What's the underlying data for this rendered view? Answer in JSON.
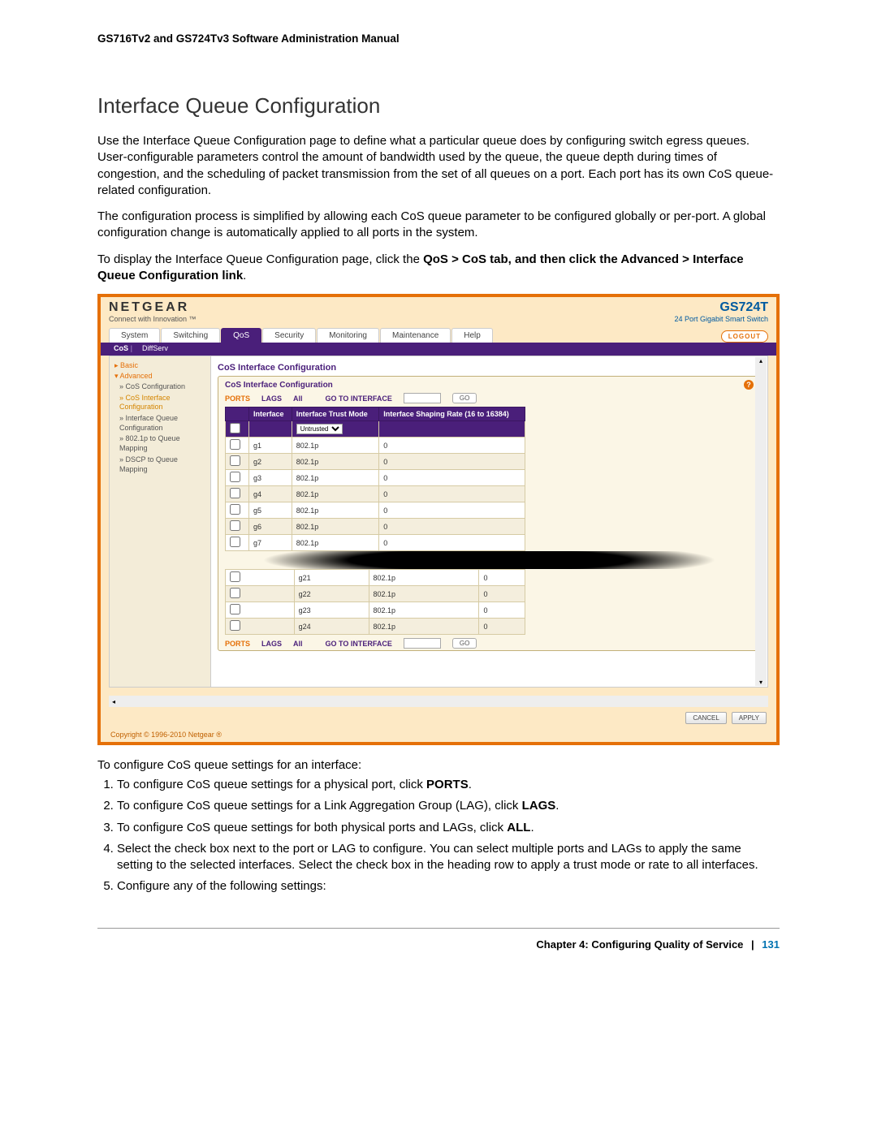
{
  "manual_header": "GS716Tv2 and GS724Tv3 Software Administration Manual",
  "h1": "Interface Queue Configuration",
  "para1": "Use the Interface Queue Configuration page to define what a particular queue does by configuring switch egress queues. User-configurable parameters control the amount of bandwidth used by the queue, the queue depth during times of congestion, and the scheduling of packet transmission from the set of all queues on a port. Each port has its own CoS queue-related configuration.",
  "para2": "The configuration process is simplified by allowing each CoS queue parameter to be configured globally or per-port. A global configuration change is automatically applied to all ports in the system.",
  "nav_prefix": "To display the Interface Queue Configuration page, click the ",
  "nav_bold": "QoS > CoS tab, and then click the Advanced > Interface Queue Configuration link",
  "nav_suffix": ".",
  "screenshot": {
    "brand_name": "NETGEAR",
    "brand_tag": "Connect with Innovation ™",
    "model": "GS724T",
    "model_sub": "24 Port Gigabit Smart Switch",
    "tabs": [
      "System",
      "Switching",
      "QoS",
      "Security",
      "Monitoring",
      "Maintenance",
      "Help"
    ],
    "active_tab": "QoS",
    "logout": "LOGOUT",
    "subtabs": [
      "CoS",
      "DiffServ"
    ],
    "active_subtab": "CoS",
    "sidebar": {
      "basic": "Basic",
      "advanced": "Advanced",
      "items": [
        "CoS Configuration",
        "CoS Interface Configuration",
        "Interface Queue Configuration",
        "802.1p to Queue Mapping",
        "DSCP to Queue Mapping"
      ],
      "active_index": 1
    },
    "section_title": "CoS Interface Configuration",
    "subsection_title": "CoS Interface Configuration",
    "filter": {
      "ports": "PORTS",
      "lags": "LAGS",
      "all": "All",
      "goto": "GO TO INTERFACE",
      "go": "GO"
    },
    "columns": [
      "",
      "Interface",
      "Interface Trust Mode",
      "Interface Shaping Rate (16 to 16384)"
    ],
    "untrusted_label": "Untrusted",
    "rows_top": [
      {
        "iface": "g1",
        "mode": "802.1p",
        "rate": "0"
      },
      {
        "iface": "g2",
        "mode": "802.1p",
        "rate": "0"
      },
      {
        "iface": "g3",
        "mode": "802.1p",
        "rate": "0"
      },
      {
        "iface": "g4",
        "mode": "802.1p",
        "rate": "0"
      },
      {
        "iface": "g5",
        "mode": "802.1p",
        "rate": "0"
      },
      {
        "iface": "g6",
        "mode": "802.1p",
        "rate": "0"
      },
      {
        "iface": "g7",
        "mode": "802.1p",
        "rate": "0"
      }
    ],
    "rows_bottom": [
      {
        "iface": "g21",
        "mode": "802.1p",
        "rate": "0"
      },
      {
        "iface": "g22",
        "mode": "802.1p",
        "rate": "0"
      },
      {
        "iface": "g23",
        "mode": "802.1p",
        "rate": "0"
      },
      {
        "iface": "g24",
        "mode": "802.1p",
        "rate": "0"
      }
    ],
    "cancel": "CANCEL",
    "apply": "APPLY",
    "copyright": "Copyright © 1996-2010 Netgear ®"
  },
  "post_text": "To configure CoS queue settings for an interface:",
  "steps": [
    {
      "text_a": "To configure CoS queue settings for a physical port, click ",
      "bold": "PORTS",
      "text_b": "."
    },
    {
      "text_a": "To configure CoS queue settings for a Link Aggregation Group (LAG), click ",
      "bold": "LAGS",
      "text_b": "."
    },
    {
      "text_a": "To configure CoS queue settings for both physical ports and LAGs, click ",
      "bold": "ALL",
      "text_b": "."
    },
    {
      "text_a": "Select the check box next to the port or LAG to configure. You can select multiple ports and LAGs to apply the same setting to the selected interfaces. Select the check box in the heading row to apply a trust mode or rate to all interfaces.",
      "bold": "",
      "text_b": ""
    },
    {
      "text_a": "Configure any of the following settings:",
      "bold": "",
      "text_b": ""
    }
  ],
  "footer": {
    "chapter": "Chapter 4:  Configuring Quality of Service",
    "sep": "|",
    "page": "131"
  }
}
